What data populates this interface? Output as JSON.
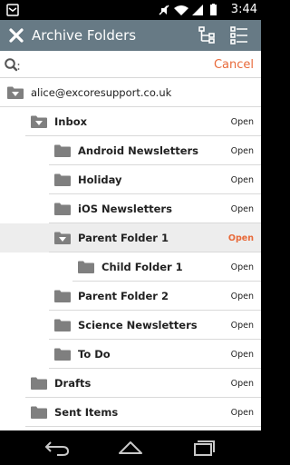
{
  "status_bar": {
    "time": "3:44"
  },
  "app_bar": {
    "title": "Archive Folders"
  },
  "search": {
    "value": "",
    "placeholder": "",
    "cancel_label": "Cancel"
  },
  "colors": {
    "accent": "#e86a3a",
    "app_bar": "#677a85",
    "folder": "#7f7f7f"
  },
  "folders": [
    {
      "name": "alice@excoresupport.co.uk",
      "level": 0,
      "type": "account",
      "expanded": true,
      "action": ""
    },
    {
      "name": "Inbox",
      "level": 1,
      "expanded": true,
      "action": "Open"
    },
    {
      "name": "Android Newsletters",
      "level": 2,
      "action": "Open"
    },
    {
      "name": "Holiday",
      "level": 2,
      "action": "Open"
    },
    {
      "name": "iOS Newsletters",
      "level": 2,
      "action": "Open"
    },
    {
      "name": "Parent Folder 1",
      "level": 2,
      "expanded": true,
      "selected": true,
      "action": "Open"
    },
    {
      "name": "Child Folder 1",
      "level": 3,
      "action": "Open"
    },
    {
      "name": "Parent Folder 2",
      "level": 2,
      "action": "Open"
    },
    {
      "name": "Science Newsletters",
      "level": 2,
      "action": "Open"
    },
    {
      "name": "To Do",
      "level": 2,
      "action": "Open"
    },
    {
      "name": "Drafts",
      "level": 1,
      "action": "Open"
    },
    {
      "name": "Sent Items",
      "level": 1,
      "action": "Open"
    }
  ]
}
